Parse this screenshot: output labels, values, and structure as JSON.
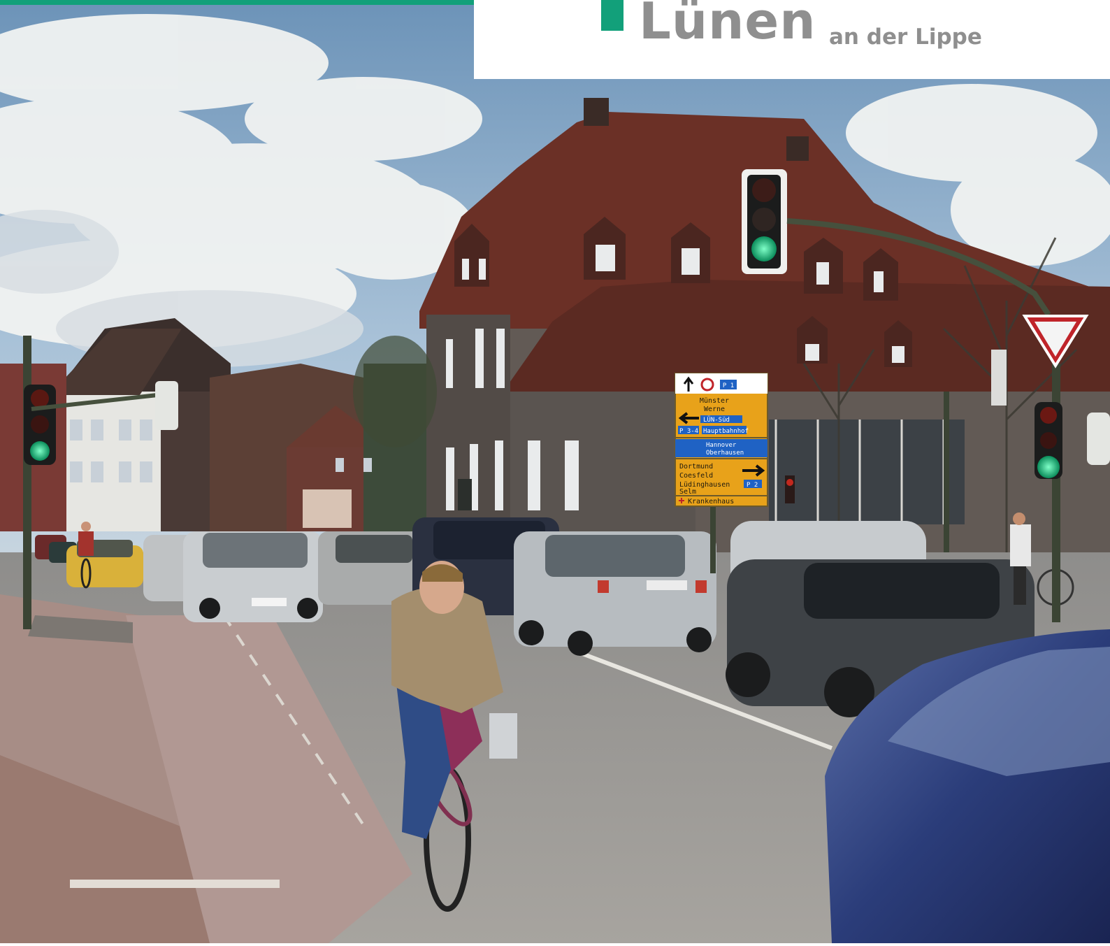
{
  "header": {
    "city": "Lünen",
    "subtitle": "an der Lippe"
  },
  "colors": {
    "brand_green": "#12a07a",
    "brand_text": "#8f8f8f",
    "sign_yellow": "#e8a21a",
    "sign_blue": "#1f62c4"
  },
  "signpost": {
    "p1": "P 1",
    "cities_north": [
      "Münster",
      "Werne"
    ],
    "lun_sud": "LÜN-Süd",
    "p34": "P 3-4",
    "hauptbahnhof": "Hauptbahnhof",
    "east": [
      "Hannover",
      "Oberhausen"
    ],
    "cities_south": [
      "Dortmund",
      "Coesfeld",
      "Lüdinghausen",
      "Selm"
    ],
    "p2": "P 2",
    "krankenhaus": "Krankenhaus"
  }
}
